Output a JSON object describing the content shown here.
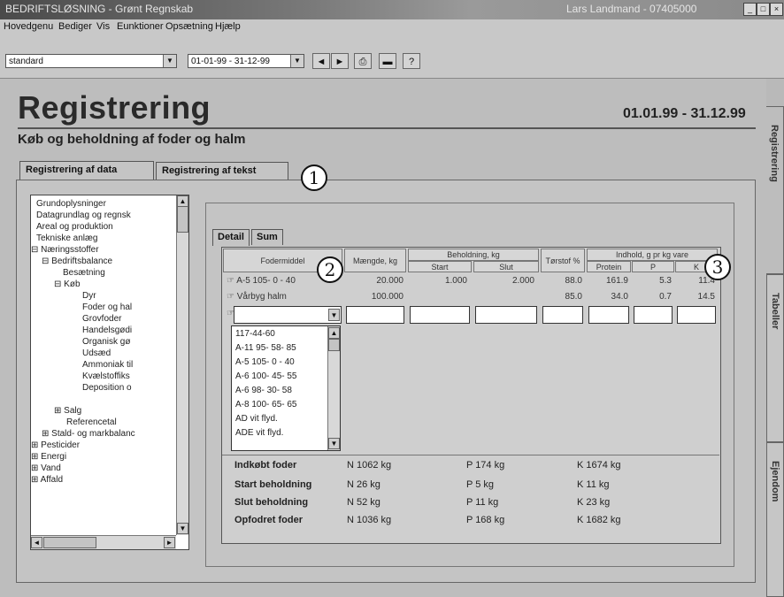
{
  "window": {
    "title": "BEDRIFTSLØSNING - Grønt Regnskab",
    "user": "Lars Landmand - 07405000",
    "buttons": [
      "_",
      "□",
      "×"
    ]
  },
  "menu": [
    "Hovedgenu",
    "Bediger",
    "Vis",
    "Eunktioner",
    "Opsætning",
    "Hjælp"
  ],
  "toolbar": {
    "profile_select": "standard",
    "period_select": "01-01-99 - 31-12-99",
    "buttons": [
      {
        "icon": "arrow-left-icon",
        "glyph": "◄"
      },
      {
        "icon": "arrow-right-icon",
        "glyph": "►"
      },
      {
        "icon": "print-icon",
        "glyph": "⎙"
      },
      {
        "icon": "save-icon",
        "glyph": "▬"
      },
      {
        "icon": "help-icon",
        "glyph": "?"
      }
    ]
  },
  "page": {
    "title": "Registrering",
    "date_range": "01.01.99 - 31.12.99",
    "subtitle": "Køb og beholdning af foder og halm"
  },
  "outer_tabs": [
    "Registrering af data",
    "Registrering af tekst"
  ],
  "side_tabs": [
    "Registrering",
    "Tabeller",
    "Ejendom"
  ],
  "tree": [
    "Grundoplysninger",
    "Datagrundlag og regnsk",
    "Areal og produktion",
    "Tekniske anlæg",
    "Næringsstoffer",
    "Bedriftsbalance",
    "Besætning",
    "Køb",
    "Dyr",
    "Foder og hal",
    "Grovfoder",
    "Handelsgødi",
    "Organisk gø",
    "Udsæd",
    "Ammoniak til",
    "Kvælstoffiks",
    "Deposition o",
    "Salg",
    "Referencetal",
    "Stald- og markbalanc",
    "Pesticider",
    "Energi",
    "Vand",
    "Affald"
  ],
  "inner_tabs": [
    "Detail",
    "Sum"
  ],
  "grid": {
    "headers": {
      "fodermiddel": "Fodermiddel",
      "maengde": "Mængde, kg",
      "beholdning": "Beholdning, kg",
      "start": "Start",
      "slut": "Slut",
      "torstof": "Tørstof %",
      "indhold": "Indhold, g pr kg vare",
      "protein": "Protein",
      "p": "P",
      "k": "K"
    },
    "rows": [
      {
        "name": "A-5 105- 0 - 40",
        "maengde": "20.000",
        "start": "1.000",
        "slut": "2.000",
        "torstof": "88.0",
        "protein": "161.9",
        "p": "5.3",
        "k": "11.4"
      },
      {
        "name": "Vårbyg halm",
        "maengde": "100.000",
        "start": "",
        "slut": "",
        "torstof": "85.0",
        "protein": "34.0",
        "p": "0.7",
        "k": "14.5"
      }
    ],
    "dropdown": [
      "117-44-60",
      "A-11 95- 58- 85",
      "A-5 105- 0 - 40",
      "A-6 100- 45- 55",
      "A-6 98- 30- 58",
      "A-8 100- 65- 65",
      "AD vit flyd.",
      "ADE vit flyd."
    ],
    "summary": [
      {
        "label": "Indkøbt foder",
        "n": "N 1062 kg",
        "p": "P 174 kg",
        "k": "K 1674 kg"
      },
      {
        "label": "Start beholdning",
        "n": "N 26 kg",
        "p": "P 5 kg",
        "k": "K 11 kg"
      },
      {
        "label": "Slut beholdning",
        "n": "N 52 kg",
        "p": "P 11 kg",
        "k": "K 23 kg"
      },
      {
        "label": "Opfodret foder",
        "n": "N 1036 kg",
        "p": "P 168 kg",
        "k": "K 1682 kg"
      }
    ]
  },
  "markers": [
    "1",
    "2",
    "3"
  ]
}
